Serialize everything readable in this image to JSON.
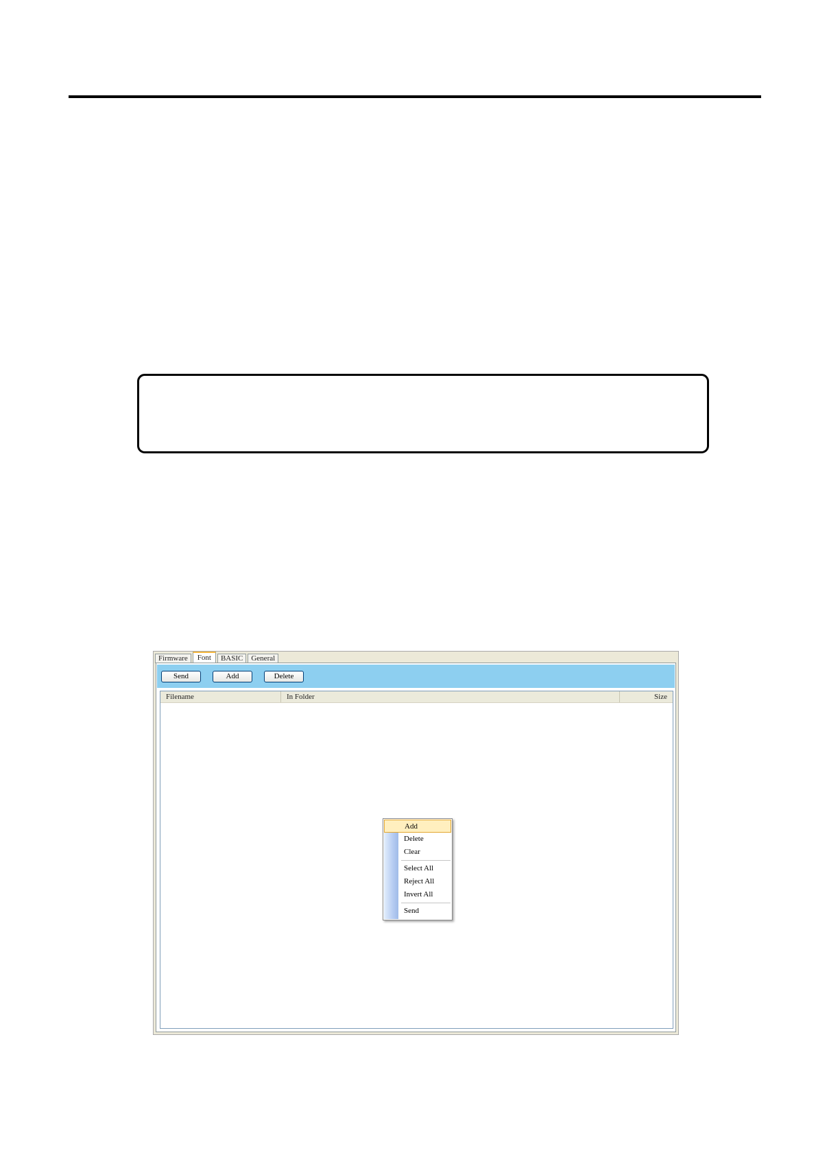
{
  "window": {
    "tabs": [
      {
        "label": "Firmware",
        "active": false
      },
      {
        "label": "Font",
        "active": true
      },
      {
        "label": "BASIC",
        "active": false
      },
      {
        "label": "General",
        "active": false
      }
    ]
  },
  "toolbar": {
    "buttons": [
      "Send",
      "Add",
      "Delete"
    ],
    "background_color": "#8dcff0"
  },
  "file_list": {
    "columns": [
      "Filename",
      "In Folder",
      "Size"
    ],
    "rows": []
  },
  "context_menu": {
    "items": [
      "Add",
      "Delete",
      "Clear",
      "Select All",
      "Reject All",
      "Invert All",
      "Send"
    ],
    "highlighted": "Add",
    "highlight_color": "#ffefbf"
  }
}
